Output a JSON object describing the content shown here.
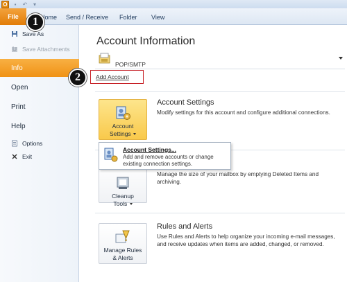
{
  "ribbon": {
    "tabs": [
      {
        "label": "File"
      },
      {
        "label": "Home"
      },
      {
        "label": "Send / Receive"
      },
      {
        "label": "Folder"
      },
      {
        "label": "View"
      }
    ]
  },
  "leftnav": {
    "save_as": "Save As",
    "save_attachments": "Save Attachments",
    "info": "Info",
    "open": "Open",
    "print": "Print",
    "help": "Help",
    "options": "Options",
    "exit": "Exit"
  },
  "main": {
    "title": "Account Information",
    "account_type": "POP/SMTP",
    "add_account": "Add Account",
    "sections": {
      "account_settings": {
        "button_line1": "Account",
        "button_line2": "Settings",
        "title": "Account Settings",
        "description": "Modify settings for this account and configure additional connections."
      },
      "cleanup": {
        "button_line1": "Cleanup",
        "button_line2": "Tools",
        "description": "Manage the size of your mailbox by emptying Deleted Items and archiving."
      },
      "rules": {
        "button_line1": "Manage Rules",
        "button_line2": "& Alerts",
        "title": "Rules and Alerts",
        "description": "Use Rules and Alerts to help organize your incoming e-mail messages, and receive updates when items are added, changed, or removed."
      }
    }
  },
  "dropdown": {
    "item_title": "Account Settings...",
    "item_description": "Add and remove accounts or change existing connection settings."
  },
  "callouts": {
    "one": "1",
    "two": "2"
  },
  "colors": {
    "file_tab": "#e27d08",
    "selected_nav": "#f09215",
    "active_button": "#f9c94b",
    "highlight_box": "#c61f25"
  }
}
